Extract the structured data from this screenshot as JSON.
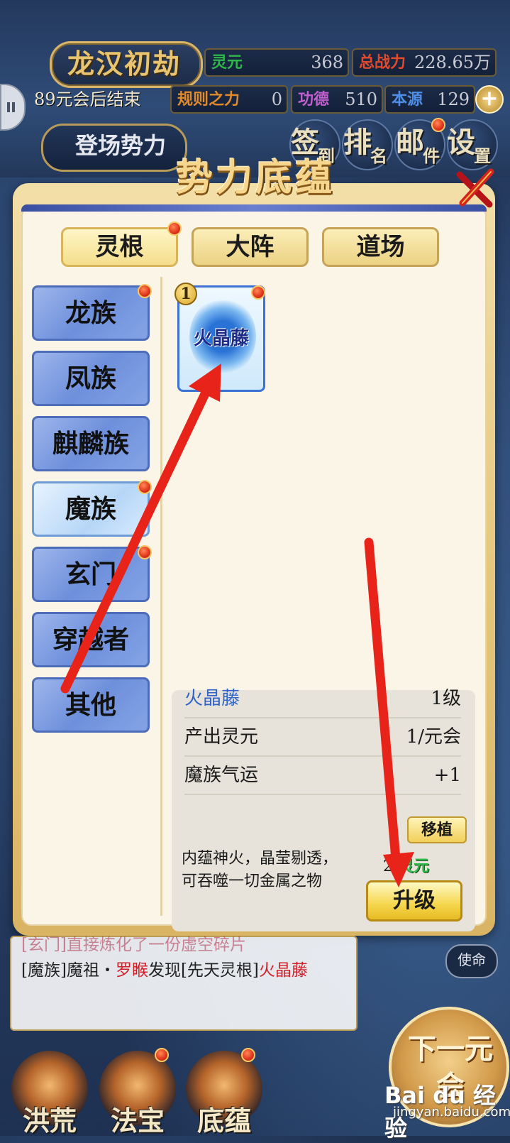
{
  "hud": {
    "title": "龙汉初劫",
    "countdown": "89元会后结束",
    "stats": [
      {
        "label": "灵元",
        "value": "368",
        "color": "#2fb84a"
      },
      {
        "label": "总战力",
        "value": "228.65万",
        "color": "#e34a2c"
      },
      {
        "label": "规则之力",
        "value": "0",
        "color": "#e08a2c"
      },
      {
        "label": "功德",
        "value": "510",
        "color": "#c05fd0"
      },
      {
        "label": "本源",
        "value": "129",
        "color": "#4f8ee6"
      }
    ],
    "faction_button": "登场势力",
    "menu": [
      {
        "big": "签",
        "small": "到"
      },
      {
        "big": "排",
        "small": "名"
      },
      {
        "big": "邮",
        "small": "件"
      },
      {
        "big": "设",
        "small": "置"
      }
    ],
    "plus_icon": "plus-icon"
  },
  "panel": {
    "title": "势力底蕴",
    "close_icon": "close-icon",
    "tabs": [
      {
        "label": "灵根",
        "active": true,
        "badge": true
      },
      {
        "label": "大阵",
        "active": false,
        "badge": false
      },
      {
        "label": "道场",
        "active": false,
        "badge": false
      }
    ],
    "sidebar": [
      {
        "label": "龙族",
        "active": false,
        "badge": true
      },
      {
        "label": "凤族",
        "active": false,
        "badge": false
      },
      {
        "label": "麒麟族",
        "active": false,
        "badge": false
      },
      {
        "label": "魔族",
        "active": true,
        "badge": true
      },
      {
        "label": "玄门",
        "active": false,
        "badge": true
      },
      {
        "label": "穿越者",
        "active": false,
        "badge": false
      },
      {
        "label": "其他",
        "active": false,
        "badge": false
      }
    ],
    "card": {
      "name": "火晶藤",
      "level_badge": "1",
      "badge": true
    },
    "info": {
      "name": "火晶藤",
      "level": "1级",
      "rows": [
        {
          "label": "产出灵元",
          "value": "1/元会"
        },
        {
          "label": "魔族气运",
          "value": "+1"
        }
      ],
      "description_line1": "内蕴神火，晶莹剔透，",
      "description_line2": "可吞噬一切金属之物",
      "move_button": "移植",
      "cost_amount": "2",
      "cost_unit": "灵元",
      "upgrade_button": "升级"
    }
  },
  "log": {
    "line1": "[玄门]直接炼化了一份虚空碎片",
    "line2_prefix": "[魔族]魔祖・",
    "line2_name": "罗睺",
    "line2_mid": "发现[先天灵根]",
    "line2_item": "火晶藤",
    "task_button": "使命"
  },
  "bottom_nav": [
    {
      "label": "洪荒",
      "badge": false
    },
    {
      "label": "法宝",
      "badge": true
    },
    {
      "label": "底蕴",
      "badge": true
    }
  ],
  "next_button": "下一元会",
  "watermark": {
    "brand": "Bai du 经验",
    "site": "jingyan.baidu.com"
  },
  "colors": {
    "accent_red": "#e8231a",
    "highlight_blue": "#2f63c9",
    "gold": "#d8b56a"
  }
}
